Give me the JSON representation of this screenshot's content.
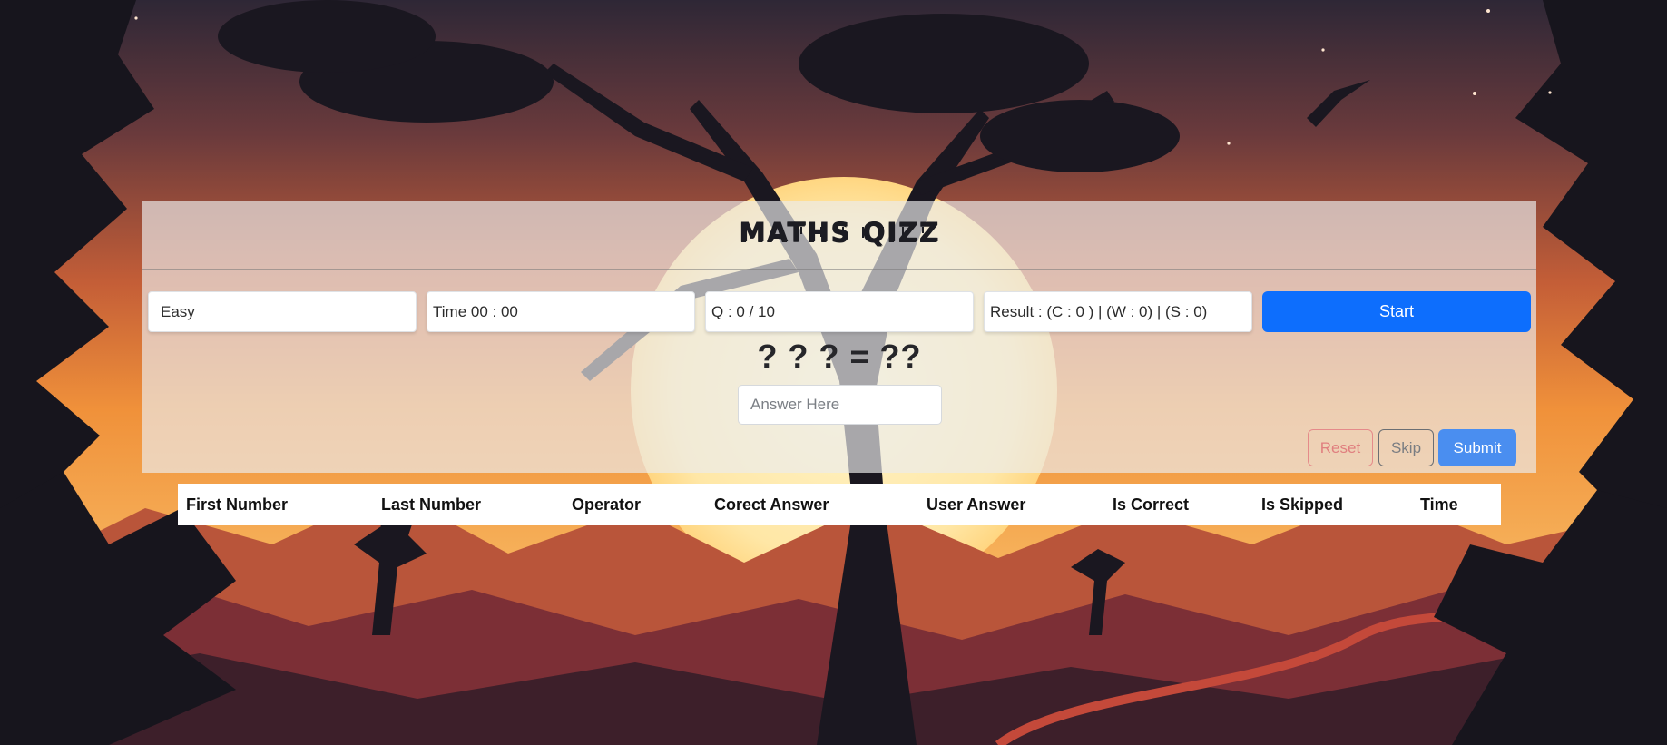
{
  "app": {
    "title": "MATHS QIZZ"
  },
  "controls": {
    "level_value": "Easy",
    "time_text": "Time 00 : 00",
    "question_text": "Q : 0 / 10",
    "result_text": "Result : (C : 0 ) | (W : 0) | (S : 0)",
    "start_label": "Start"
  },
  "question": {
    "equation_text": "? ? ? = ??",
    "answer_placeholder": "Answer Here"
  },
  "actions": {
    "reset_label": "Reset",
    "skip_label": "Skip",
    "submit_label": "Submit"
  },
  "table": {
    "headers": [
      "First Number",
      "Last Number",
      "Operator",
      "Corect Answer",
      "User Answer",
      "Is Correct",
      "Is Skipped",
      "Time"
    ],
    "rows": []
  },
  "colors": {
    "primary": "#0d6efd",
    "danger": "#e07f7f",
    "secondary": "#7a7d82",
    "submit": "#4a8ef0"
  }
}
